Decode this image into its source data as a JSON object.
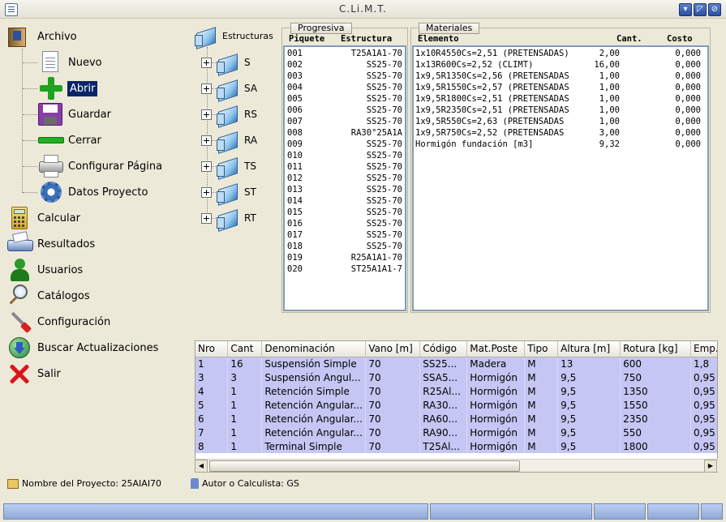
{
  "window": {
    "title": "C.Li.M.T."
  },
  "menu": {
    "archivo": "Archivo",
    "nuevo": "Nuevo",
    "abrir": "Abrir",
    "guardar": "Guardar",
    "cerrar": "Cerrar",
    "configurar_pagina": "Configurar Página",
    "datos_proyecto": "Datos Proyecto",
    "calcular": "Calcular",
    "resultados": "Resultados",
    "usuarios": "Usuarios",
    "catalogos": "Catálogos",
    "configuracion": "Configuración",
    "buscar_actualizaciones": "Buscar Actualizaciones",
    "salir": "Salir"
  },
  "estructuras": {
    "title": "Estructuras",
    "items": [
      "S",
      "SA",
      "RS",
      "RA",
      "TS",
      "ST",
      "RT"
    ]
  },
  "progresiva": {
    "tab": "Progresiva",
    "headers": [
      "Piquete",
      "Estructura"
    ],
    "rows": [
      [
        "001",
        "T25A1A1-70"
      ],
      [
        "002",
        "SS25-70"
      ],
      [
        "003",
        "SS25-70"
      ],
      [
        "004",
        "SS25-70"
      ],
      [
        "005",
        "SS25-70"
      ],
      [
        "006",
        "SS25-70"
      ],
      [
        "007",
        "SS25-70"
      ],
      [
        "008",
        "RA30°25A1A"
      ],
      [
        "009",
        "SS25-70"
      ],
      [
        "010",
        "SS25-70"
      ],
      [
        "011",
        "SS25-70"
      ],
      [
        "012",
        "SS25-70"
      ],
      [
        "013",
        "SS25-70"
      ],
      [
        "014",
        "SS25-70"
      ],
      [
        "015",
        "SS25-70"
      ],
      [
        "016",
        "SS25-70"
      ],
      [
        "017",
        "SS25-70"
      ],
      [
        "018",
        "SS25-70"
      ],
      [
        "019",
        "R25A1A1-70"
      ],
      [
        "020",
        "ST25A1A1-7"
      ]
    ]
  },
  "materiales": {
    "tab": "Materiales",
    "headers": [
      "Elemento",
      "Cant.",
      "Costo"
    ],
    "rows": [
      [
        "1x10R4550Cs=2,51 (PRETENSADAS)",
        "2,00",
        "0,000"
      ],
      [
        "1x13R600Cs=2,52 (CLIMT)",
        "16,00",
        "0,000"
      ],
      [
        "1x9,5R1350Cs=2,56 (PRETENSADAS",
        "1,00",
        "0,000"
      ],
      [
        "1x9,5R1550Cs=2,57 (PRETENSADAS",
        "1,00",
        "0,000"
      ],
      [
        "1x9,5R1800Cs=2,51 (PRETENSADAS",
        "1,00",
        "0,000"
      ],
      [
        "1x9,5R2350Cs=2,51 (PRETENSADAS",
        "1,00",
        "0,000"
      ],
      [
        "1x9,5R550Cs=2,63 (PRETENSADAS",
        "1,00",
        "0,000"
      ],
      [
        "1x9,5R750Cs=2,52 (PRETENSADAS",
        "3,00",
        "0,000"
      ],
      [
        "Hormigón fundación [m3]",
        "9,32",
        "0,000"
      ]
    ]
  },
  "grid": {
    "headers": [
      "Nro",
      "Cant",
      "Denominación",
      "Vano [m]",
      "Código",
      "Mat.Poste",
      "Tipo",
      "Altura [m]",
      "Rotura [kg]",
      "Emp."
    ],
    "rows": [
      [
        "1",
        "16",
        "Suspensión Simple",
        "70",
        "SS25...",
        "Madera",
        "M",
        "13",
        "600",
        "1,8"
      ],
      [
        "3",
        "3",
        "Suspensión Angul...",
        "70",
        "SSA5...",
        "Hormigón",
        "M",
        "9,5",
        "750",
        "0,95"
      ],
      [
        "4",
        "1",
        "Retención Simple",
        "70",
        "R25Al...",
        "Hormigón",
        "M",
        "9,5",
        "1350",
        "0,95"
      ],
      [
        "5",
        "1",
        "Retención Angular...",
        "70",
        "RA30...",
        "Hormigón",
        "M",
        "9,5",
        "1550",
        "0,95"
      ],
      [
        "6",
        "1",
        "Retención Angular...",
        "70",
        "RA60...",
        "Hormigón",
        "M",
        "9,5",
        "2350",
        "0,95"
      ],
      [
        "7",
        "1",
        "Retención Angular...",
        "70",
        "RA90...",
        "Hormigón",
        "M",
        "9,5",
        "550",
        "0,95"
      ],
      [
        "8",
        "1",
        "Terminal Simple",
        "70",
        "T25Al...",
        "Hormigón",
        "M",
        "9,5",
        "1800",
        "0,95"
      ]
    ]
  },
  "footer": {
    "project": "Nombre del Proyecto: 25AIAI70",
    "author": "Autor o Calculista: GS"
  },
  "colors": {
    "grid_row": "#c6c6f4",
    "selection": "#0a246a"
  }
}
